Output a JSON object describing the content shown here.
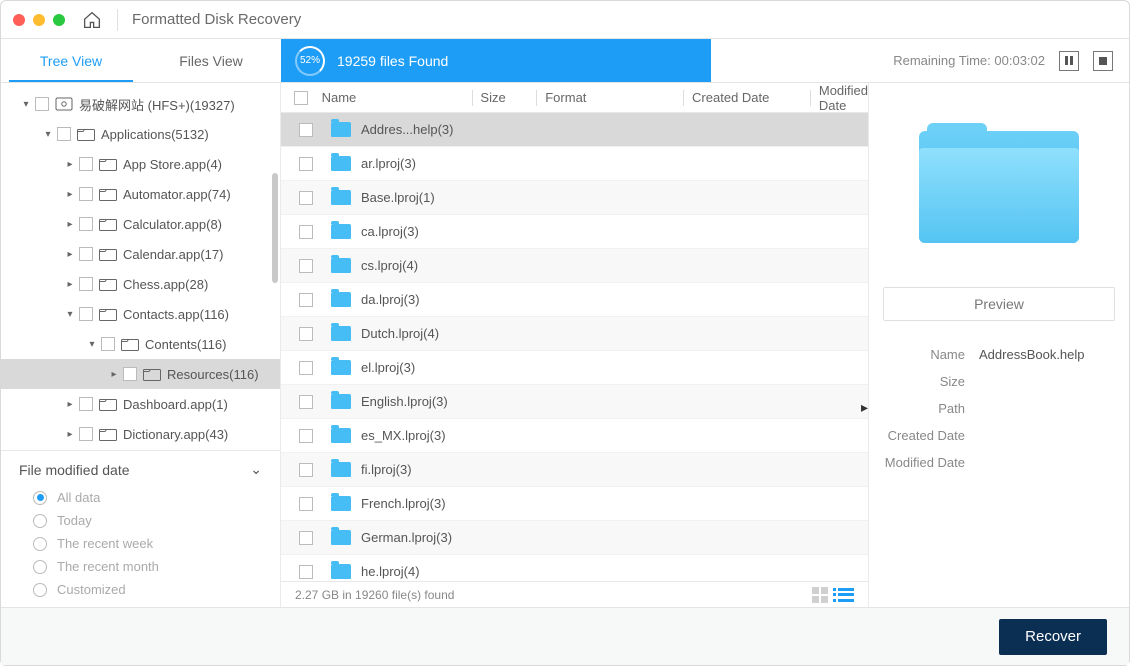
{
  "title": "Formatted Disk Recovery",
  "tabs": {
    "tree": "Tree View",
    "files": "Files View"
  },
  "scan": {
    "percent": "52%",
    "found": "19259 files Found"
  },
  "remaining": {
    "label": "Remaining Time:",
    "value": "00:03:02"
  },
  "tree": [
    {
      "indent": 0,
      "arrow": "▾",
      "icon": "disk",
      "label": "易破解网站 (HFS+)(19327)"
    },
    {
      "indent": 1,
      "arrow": "▾",
      "icon": "folder",
      "label": "Applications(5132)"
    },
    {
      "indent": 2,
      "arrow": "▸",
      "icon": "folder",
      "label": "App Store.app(4)"
    },
    {
      "indent": 2,
      "arrow": "▸",
      "icon": "folder",
      "label": "Automator.app(74)"
    },
    {
      "indent": 2,
      "arrow": "▸",
      "icon": "folder",
      "label": "Calculator.app(8)"
    },
    {
      "indent": 2,
      "arrow": "▸",
      "icon": "folder",
      "label": "Calendar.app(17)"
    },
    {
      "indent": 2,
      "arrow": "▸",
      "icon": "folder",
      "label": "Chess.app(28)"
    },
    {
      "indent": 2,
      "arrow": "▾",
      "icon": "folder",
      "label": "Contacts.app(116)"
    },
    {
      "indent": 3,
      "arrow": "▾",
      "icon": "folder",
      "label": "Contents(116)"
    },
    {
      "indent": 4,
      "arrow": "▸",
      "icon": "folder",
      "label": "Resources(116)",
      "selected": true
    },
    {
      "indent": 2,
      "arrow": "▸",
      "icon": "folder",
      "label": "Dashboard.app(1)"
    },
    {
      "indent": 2,
      "arrow": "▸",
      "icon": "folder",
      "label": "Dictionary.app(43)"
    }
  ],
  "columns": {
    "name": "Name",
    "size": "Size",
    "format": "Format",
    "created": "Created Date",
    "modified": "Modified Date"
  },
  "rows": [
    {
      "label": "Addres...help(3)",
      "selected": true
    },
    {
      "label": "ar.lproj(3)"
    },
    {
      "label": "Base.lproj(1)",
      "alt": true
    },
    {
      "label": "ca.lproj(3)"
    },
    {
      "label": "cs.lproj(4)",
      "alt": true
    },
    {
      "label": "da.lproj(3)"
    },
    {
      "label": "Dutch.lproj(4)",
      "alt": true
    },
    {
      "label": "el.lproj(3)"
    },
    {
      "label": "English.lproj(3)",
      "alt": true
    },
    {
      "label": "es_MX.lproj(3)"
    },
    {
      "label": "fi.lproj(3)",
      "alt": true
    },
    {
      "label": "French.lproj(3)"
    },
    {
      "label": "German.lproj(3)",
      "alt": true
    },
    {
      "label": "he.lproj(4)"
    }
  ],
  "status": "2.27 GB in 19260 file(s) found",
  "filter": {
    "title": "File modified date",
    "options": [
      "All data",
      "Today",
      "The recent week",
      "The recent month",
      "Customized"
    ]
  },
  "preview": {
    "button": "Preview",
    "meta": {
      "name_label": "Name",
      "name_value": "AddressBook.help",
      "size_label": "Size",
      "size_value": "",
      "path_label": "Path",
      "path_value": "",
      "created_label": "Created Date",
      "created_value": "",
      "modified_label": "Modified Date",
      "modified_value": ""
    }
  },
  "recover": "Recover"
}
